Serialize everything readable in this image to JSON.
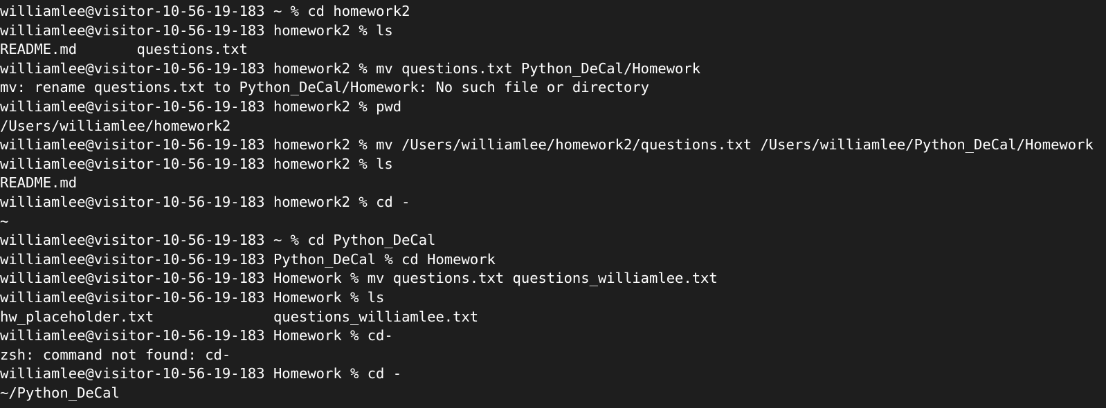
{
  "terminal": {
    "background": "#1e1e1e",
    "foreground": "#ffffff",
    "lines": [
      {
        "prompt": "williamlee@visitor-10-56-19-183 ~ % ",
        "command": "cd homework2"
      },
      {
        "prompt": "williamlee@visitor-10-56-19-183 homework2 % ",
        "command": "ls"
      },
      {
        "output": "README.md       questions.txt"
      },
      {
        "prompt": "williamlee@visitor-10-56-19-183 homework2 % ",
        "command": "mv questions.txt Python_DeCal/Homework"
      },
      {
        "output": "mv: rename questions.txt to Python_DeCal/Homework: No such file or directory"
      },
      {
        "prompt": "williamlee@visitor-10-56-19-183 homework2 % ",
        "command": "pwd"
      },
      {
        "output": "/Users/williamlee/homework2"
      },
      {
        "prompt": "williamlee@visitor-10-56-19-183 homework2 % ",
        "command": "mv /Users/williamlee/homework2/questions.txt /Users/williamlee/Python_DeCal/Homework"
      },
      {
        "prompt": "williamlee@visitor-10-56-19-183 homework2 % ",
        "command": "ls"
      },
      {
        "output": "README.md"
      },
      {
        "prompt": "williamlee@visitor-10-56-19-183 homework2 % ",
        "command": "cd -"
      },
      {
        "output": "~"
      },
      {
        "prompt": "williamlee@visitor-10-56-19-183 ~ % ",
        "command": "cd Python_DeCal"
      },
      {
        "prompt": "williamlee@visitor-10-56-19-183 Python_DeCal % ",
        "command": "cd Homework"
      },
      {
        "prompt": "williamlee@visitor-10-56-19-183 Homework % ",
        "command": "mv questions.txt questions_williamlee.txt"
      },
      {
        "prompt": "williamlee@visitor-10-56-19-183 Homework % ",
        "command": "ls"
      },
      {
        "output": "hw_placeholder.txt              questions_williamlee.txt"
      },
      {
        "prompt": "williamlee@visitor-10-56-19-183 Homework % ",
        "command": "cd-"
      },
      {
        "output": "zsh: command not found: cd-"
      },
      {
        "prompt": "williamlee@visitor-10-56-19-183 Homework % ",
        "command": "cd -"
      },
      {
        "output": "~/Python_DeCal"
      }
    ]
  }
}
